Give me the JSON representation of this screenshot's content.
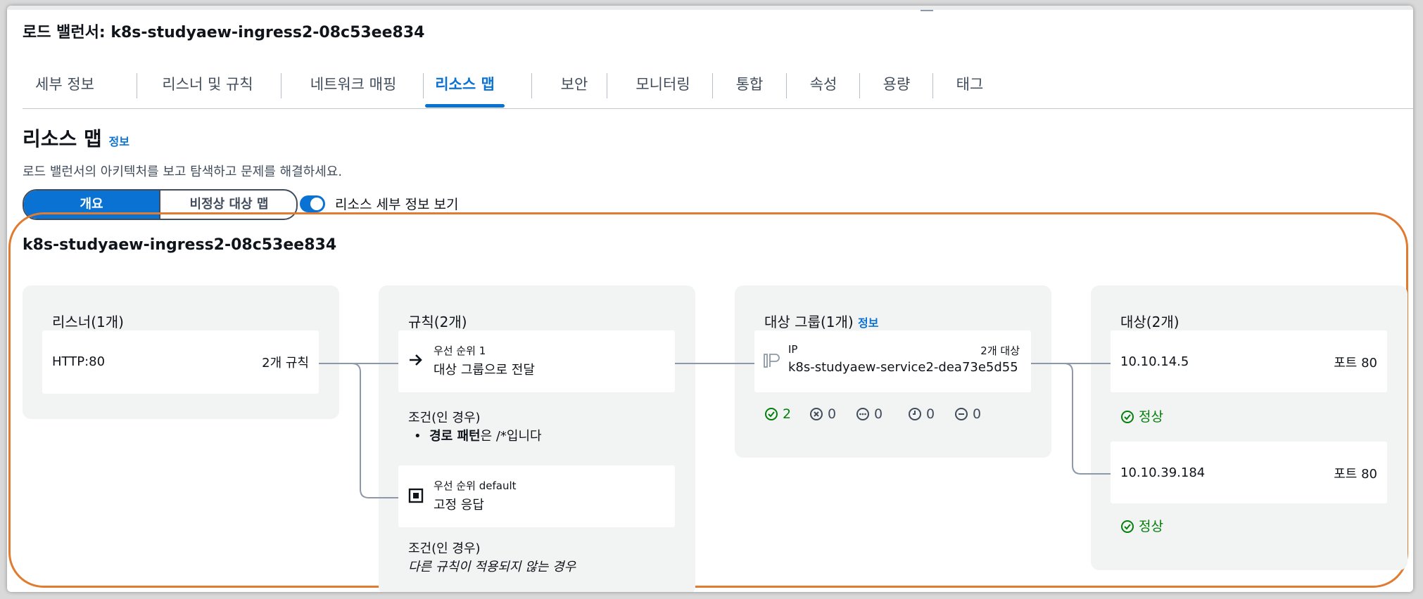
{
  "page": {
    "title": "로드 밸런서: k8s-studyaew-ingress2-08c53ee834"
  },
  "tabs": [
    {
      "label": "세부 정보",
      "active": false
    },
    {
      "label": "리스너 및 규칙",
      "active": false
    },
    {
      "label": "네트워크 매핑",
      "active": false
    },
    {
      "label": "리소스 맵",
      "active": true
    },
    {
      "label": "보안",
      "active": false
    },
    {
      "label": "모니터링",
      "active": false
    },
    {
      "label": "통합",
      "active": false
    },
    {
      "label": "속성",
      "active": false
    },
    {
      "label": "용량",
      "active": false
    },
    {
      "label": "태그",
      "active": false
    }
  ],
  "section": {
    "title": "리소스 맵",
    "info": "정보",
    "description": "로드 밸런서의 아키텍처를 보고 탐색하고 문제를 해결하세요."
  },
  "view_toggle": {
    "overview": "개요",
    "unhealthy": "비정상 대상 맵",
    "details_label": "리소스 세부 정보 보기",
    "details_on": true
  },
  "map": {
    "lb_name": "k8s-studyaew-ingress2-08c53ee834",
    "listeners": {
      "title": "리스너(1개)",
      "items": [
        {
          "protocol": "HTTP:80",
          "rules": "2개 규칙"
        }
      ]
    },
    "rules": {
      "title": "규칙(2개)",
      "items": [
        {
          "priority": "우선 순위 1",
          "action": "대상 그룹으로 전달",
          "condition_title": "조건(인 경우)",
          "condition_bold": "경로 패턴",
          "condition_rest": "은 /*입니다"
        },
        {
          "priority": "우선 순위 default",
          "action": "고정 응답",
          "condition_title": "조건(인 경우)",
          "condition_text": "다른 규칙이 적용되지 않는 경우"
        }
      ]
    },
    "target_groups": {
      "title": "대상 그룹(1개)",
      "info": "정보",
      "items": [
        {
          "type": "IP",
          "count": "2개 대상",
          "name": "k8s-studyaew-service2-dea73e5d55",
          "stats": {
            "healthy": "2",
            "unhealthy": "0",
            "other": "0",
            "pending": "0",
            "unused": "0"
          }
        }
      ]
    },
    "targets": {
      "title": "대상(2개)",
      "items": [
        {
          "ip": "10.10.14.5",
          "port": "포트 80",
          "status": "정상"
        },
        {
          "ip": "10.10.39.184",
          "port": "포트 80",
          "status": "정상"
        }
      ]
    }
  },
  "colors": {
    "accent": "#0972d3",
    "healthy": "#037f0c",
    "highlight": "#e07b2f"
  }
}
